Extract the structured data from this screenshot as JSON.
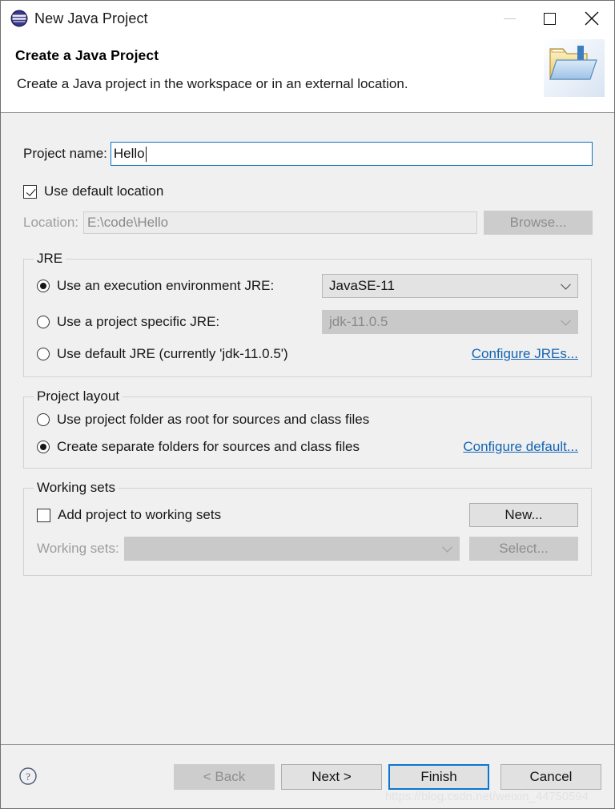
{
  "window": {
    "title": "New Java Project",
    "icon": "eclipse-icon",
    "controls": {
      "minimize": "minimize-icon",
      "maximize": "maximize-icon",
      "close": "close-icon"
    }
  },
  "header": {
    "title": "Create a Java Project",
    "description": "Create a Java project in the workspace or in an external location.",
    "icon": "java-project-folder-icon"
  },
  "project_name": {
    "label": "Project name:",
    "value": "Hello"
  },
  "location": {
    "checkbox_label": "Use default location",
    "checkbox_checked": true,
    "label": "Location:",
    "value": "E:\\code\\Hello",
    "browse_label": "Browse...",
    "browse_enabled": false
  },
  "jre": {
    "group_title": "JRE",
    "options": [
      {
        "label": "Use an execution environment JRE:",
        "selected": true,
        "combo_value": "JavaSE-11",
        "combo_enabled": true
      },
      {
        "label": "Use a project specific JRE:",
        "selected": false,
        "combo_value": "jdk-11.0.5",
        "combo_enabled": false
      },
      {
        "label": "Use default JRE (currently 'jdk-11.0.5')",
        "selected": false
      }
    ],
    "configure_link": "Configure JREs..."
  },
  "project_layout": {
    "group_title": "Project layout",
    "options": [
      {
        "label": "Use project folder as root for sources and class files",
        "selected": false
      },
      {
        "label": "Create separate folders for sources and class files",
        "selected": true
      }
    ],
    "configure_link": "Configure default..."
  },
  "working_sets": {
    "group_title": "Working sets",
    "checkbox_label": "Add project to working sets",
    "checkbox_checked": false,
    "new_label": "New...",
    "label": "Working sets:",
    "combo_value": "",
    "select_label": "Select...",
    "select_enabled": false
  },
  "footer": {
    "help_icon": "help-icon",
    "back_label": "< Back",
    "back_enabled": false,
    "next_label": "Next >",
    "finish_label": "Finish",
    "finish_focused": true,
    "cancel_label": "Cancel"
  },
  "watermark": "https://blog.csdn.net/weixin_44750594",
  "colors": {
    "accent_blue": "#0a76d3",
    "link_blue": "#1464b4",
    "dialog_bg": "#f0f0f0",
    "header_bg": "#ffffff"
  }
}
